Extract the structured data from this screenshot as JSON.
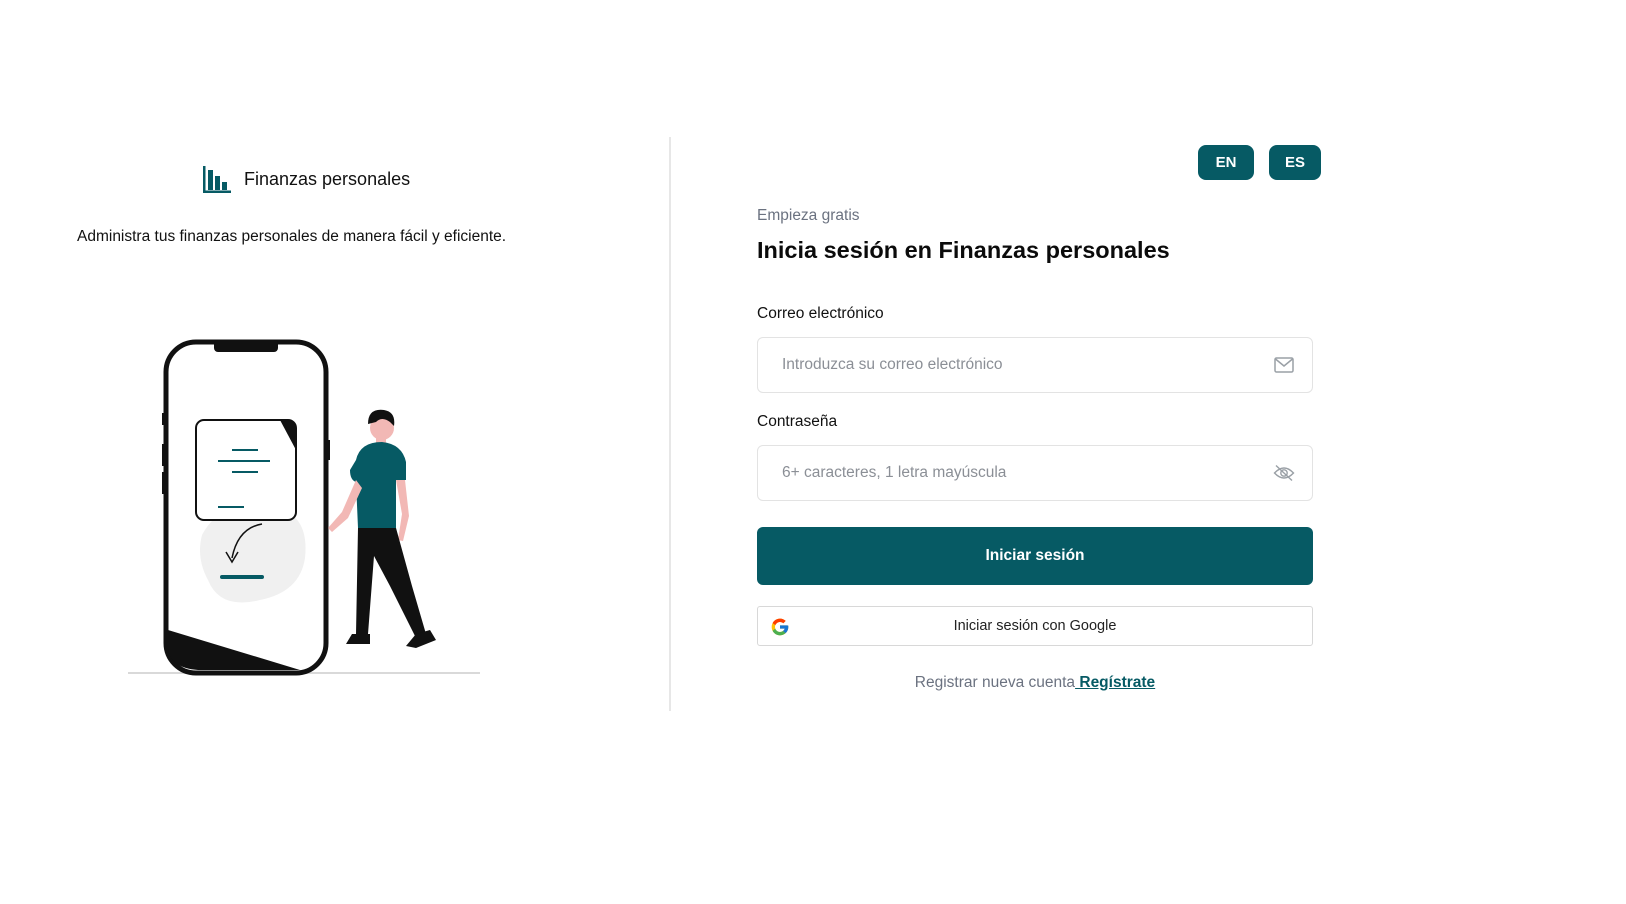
{
  "brand": {
    "name": "Finanzas personales",
    "icon": "bar-chart-icon",
    "tagline": "Administra tus finanzas personales de manera fácil y eficiente."
  },
  "illustration": {
    "name": "phone-person-illustration"
  },
  "language": {
    "en_label": "EN",
    "es_label": "ES"
  },
  "login": {
    "eyebrow": "Empieza gratis",
    "title": "Inicia sesión en Finanzas personales",
    "email_label": "Correo electrónico",
    "email_placeholder": "Introduzca su correo electrónico",
    "email_value": "",
    "password_label": "Contraseña",
    "password_placeholder": "6+ caracteres, 1 letra mayúscula",
    "password_value": "",
    "submit_label": "Iniciar sesión",
    "google_label": "Iniciar sesión con Google",
    "register_text": "Registrar nueva cuenta",
    "register_link": " Regístrate"
  },
  "colors": {
    "accent": "#065a64",
    "muted_text": "#6b7280",
    "border": "#e3e3e3"
  }
}
